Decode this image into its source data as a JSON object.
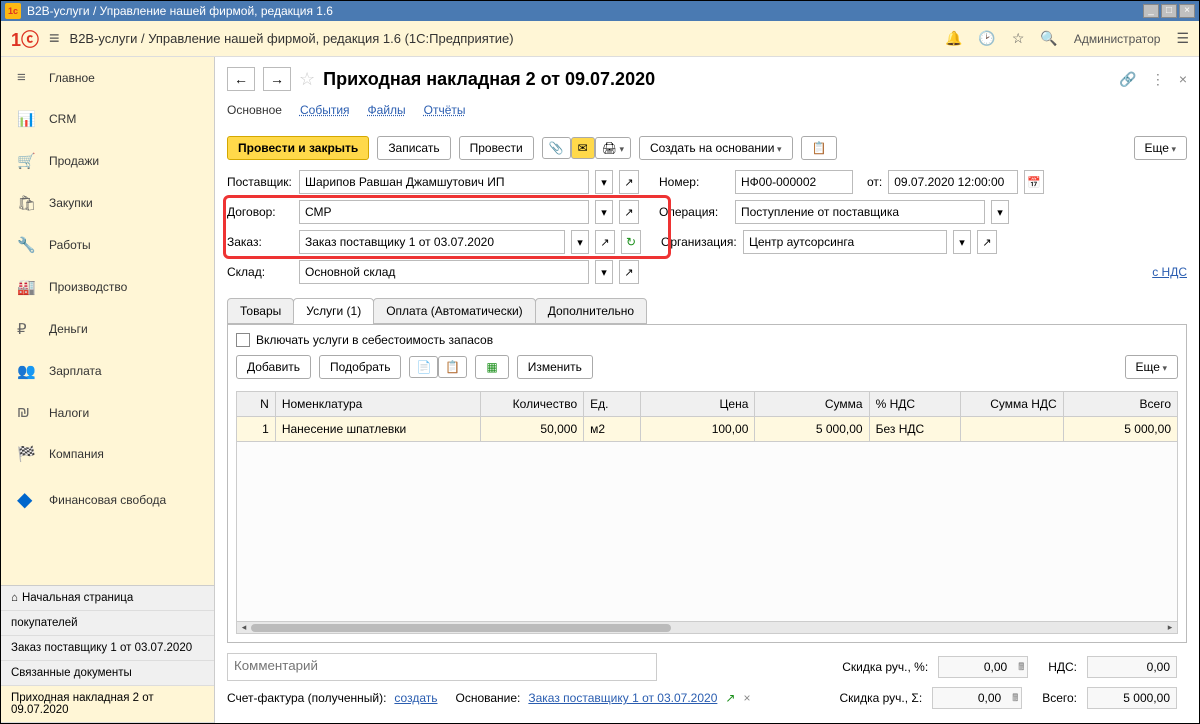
{
  "titlebar": {
    "title": "B2B-услуги / Управление нашей фирмой, редакция 1.6"
  },
  "toolbar": {
    "breadcrumb": "B2B-услуги / Управление нашей фирмой, редакция 1.6  (1С:Предприятие)",
    "admin": "Администратор"
  },
  "sidebar": {
    "items": [
      {
        "icon": "≡",
        "label": "Главное"
      },
      {
        "icon": "📊",
        "label": "CRM"
      },
      {
        "icon": "🛒",
        "label": "Продажи"
      },
      {
        "icon": "🛍",
        "label": "Закупки"
      },
      {
        "icon": "🔧",
        "label": "Работы"
      },
      {
        "icon": "🏭",
        "label": "Производство"
      },
      {
        "icon": "₽",
        "label": "Деньги"
      },
      {
        "icon": "👥",
        "label": "Зарплата"
      },
      {
        "icon": "₪",
        "label": "Налоги"
      },
      {
        "icon": "🏁",
        "label": "Компания"
      },
      {
        "icon": "◆",
        "label": "Финансовая свобода"
      }
    ],
    "bottom": {
      "home": "Начальная страница",
      "buyers": "покупателей",
      "order": "Заказ поставщику 1 от 03.07.2020",
      "related": "Связанные документы",
      "current": "Приходная накладная 2 от 09.07.2020"
    }
  },
  "doc": {
    "title": "Приходная накладная 2 от 09.07.2020",
    "tabs": {
      "main": "Основное",
      "events": "События",
      "files": "Файлы",
      "reports": "Отчёты"
    },
    "actions": {
      "post_close": "Провести и закрыть",
      "save": "Записать",
      "post": "Провести",
      "create_based": "Создать на основании",
      "more": "Еще"
    },
    "fields": {
      "supplier_label": "Поставщик:",
      "supplier_value": "Шарипов Равшан Джамшутович ИП",
      "number_label": "Номер:",
      "number_value": "НФ00-000002",
      "from_label": "от:",
      "date_value": "09.07.2020 12:00:00",
      "contract_label": "Договор:",
      "contract_value": "СМР",
      "operation_label": "Операция:",
      "operation_value": "Поступление от поставщика",
      "order_label": "Заказ:",
      "order_value": "Заказ поставщику 1 от 03.07.2020",
      "org_label": "Организация:",
      "org_value": "Центр аутсорсинга",
      "warehouse_label": "Склад:",
      "warehouse_value": "Основной склад",
      "vat_link": "с НДС"
    },
    "sub_tabs": {
      "goods": "Товары",
      "services": "Услуги (1)",
      "payment": "Оплата (Автоматически)",
      "additional": "Дополнительно"
    },
    "services": {
      "include_cost": "Включать услуги в себестоимость запасов",
      "add": "Добавить",
      "select": "Подобрать",
      "edit": "Изменить",
      "more": "Еще",
      "columns": {
        "n": "N",
        "nomenclature": "Номенклатура",
        "qty": "Количество",
        "unit": "Ед.",
        "price": "Цена",
        "sum": "Сумма",
        "vat_pct": "% НДС",
        "vat_sum": "Сумма НДС",
        "total": "Всего"
      },
      "rows": [
        {
          "n": "1",
          "name": "Нанесение шпатлевки",
          "qty": "50,000",
          "unit": "м2",
          "price": "100,00",
          "sum": "5 000,00",
          "vat_pct": "Без НДС",
          "vat_sum": "",
          "total": "5 000,00"
        }
      ]
    },
    "footer": {
      "comment_placeholder": "Комментарий",
      "discount_pct_label": "Скидка руч., %:",
      "discount_pct_value": "0,00",
      "discount_sum_label": "Скидка руч., Σ:",
      "discount_sum_value": "0,00",
      "vat_label": "НДС:",
      "vat_value": "0,00",
      "total_label": "Всего:",
      "total_value": "5 000,00",
      "invoice_label": "Счет-фактура (полученный):",
      "invoice_create": "создать",
      "basis_label": "Основание:",
      "basis_value": "Заказ поставщику 1 от 03.07.2020"
    }
  }
}
